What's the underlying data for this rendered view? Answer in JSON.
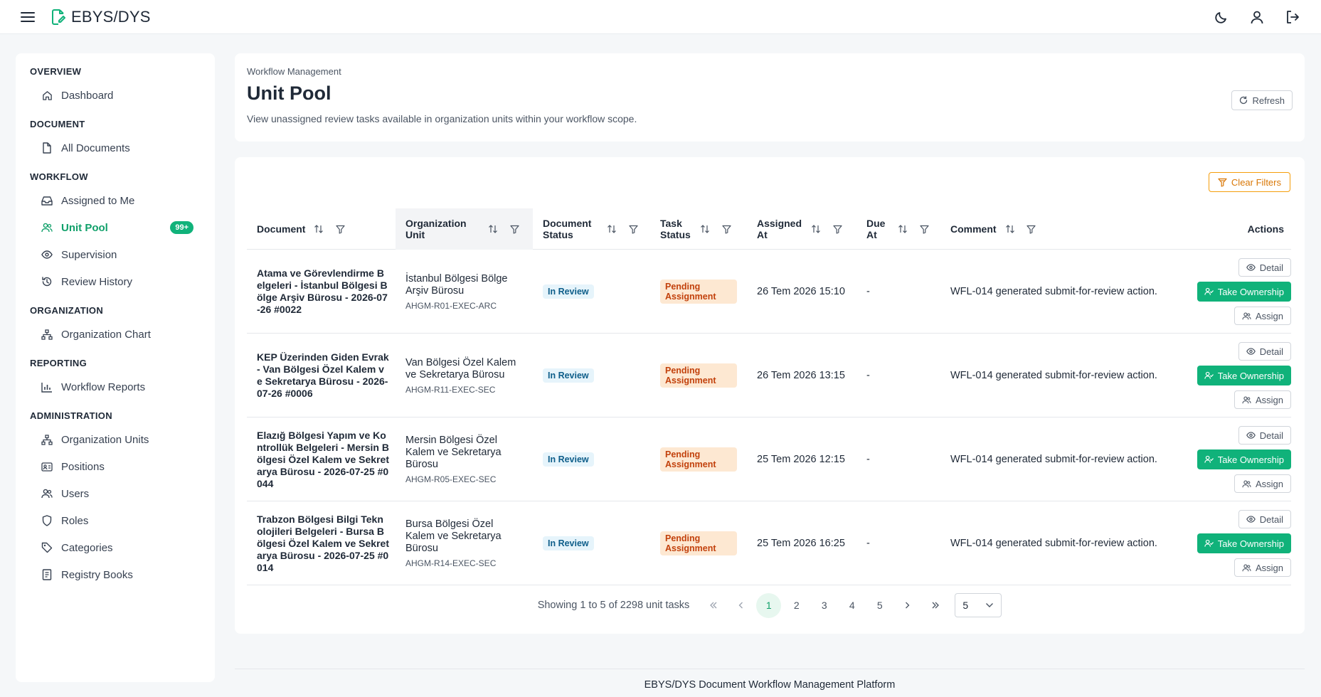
{
  "app": {
    "title": "EBYS/DYS"
  },
  "sidebar": {
    "sections": [
      {
        "label": "OVERVIEW",
        "items": [
          {
            "label": "Dashboard",
            "icon": "home-icon"
          }
        ]
      },
      {
        "label": "DOCUMENT",
        "items": [
          {
            "label": "All Documents",
            "icon": "file-icon"
          }
        ]
      },
      {
        "label": "WORKFLOW",
        "items": [
          {
            "label": "Assigned to Me",
            "icon": "inbox-icon"
          },
          {
            "label": "Unit Pool",
            "icon": "users-icon",
            "active": true,
            "badge": "99+"
          },
          {
            "label": "Supervision",
            "icon": "eye-icon"
          },
          {
            "label": "Review History",
            "icon": "history-icon"
          }
        ]
      },
      {
        "label": "ORGANIZATION",
        "items": [
          {
            "label": "Organization Chart",
            "icon": "sitemap-icon"
          }
        ]
      },
      {
        "label": "REPORTING",
        "items": [
          {
            "label": "Workflow Reports",
            "icon": "chart-icon"
          }
        ]
      },
      {
        "label": "ADMINISTRATION",
        "items": [
          {
            "label": "Organization Units",
            "icon": "sitemap-icon"
          },
          {
            "label": "Positions",
            "icon": "id-card-icon"
          },
          {
            "label": "Users",
            "icon": "users-icon"
          },
          {
            "label": "Roles",
            "icon": "shield-icon"
          },
          {
            "label": "Categories",
            "icon": "tag-icon"
          },
          {
            "label": "Registry Books",
            "icon": "book-icon"
          }
        ]
      }
    ]
  },
  "header": {
    "breadcrumb": "Workflow Management",
    "title": "Unit Pool",
    "description": "View unassigned review tasks available in organization units within your workflow scope.",
    "refresh_label": "Refresh"
  },
  "table": {
    "clear_filters_label": "Clear Filters",
    "columns": {
      "document": "Document",
      "org_unit": "Organization Unit",
      "doc_status": "Document Status",
      "task_status": "Task Status",
      "assigned_at": "Assigned At",
      "due_at": "Due At",
      "comment": "Comment",
      "actions": "Actions"
    },
    "action_labels": {
      "detail": "Detail",
      "take": "Take Ownership",
      "assign": "Assign"
    },
    "rows": [
      {
        "document": "Atama ve Görevlendirme Belgeleri - İstanbul Bölgesi Bölge Arşiv Bürosu - 2026-07-26 #0022",
        "org_name": "İstanbul Bölgesi Bölge Arşiv Bürosu",
        "org_code": "AHGM-R01-EXEC-ARC",
        "doc_status": "In Review",
        "task_status": "Pending Assignment",
        "assigned_at": "26 Tem 2026 15:10",
        "due_at": "-",
        "comment": "WFL-014 generated submit-for-review action."
      },
      {
        "document": "KEP Üzerinden Giden Evrak - Van Bölgesi Özel Kalem ve Sekretarya Bürosu - 2026-07-26 #0006",
        "org_name": "Van Bölgesi Özel Kalem ve Sekretarya Bürosu",
        "org_code": "AHGM-R11-EXEC-SEC",
        "doc_status": "In Review",
        "task_status": "Pending Assignment",
        "assigned_at": "26 Tem 2026 13:15",
        "due_at": "-",
        "comment": "WFL-014 generated submit-for-review action."
      },
      {
        "document": "Elazığ Bölgesi Yapım ve Kontrollük Belgeleri - Mersin Bölgesi Özel Kalem ve Sekretarya Bürosu - 2026-07-25 #0044",
        "org_name": "Mersin Bölgesi Özel Kalem ve Sekretarya Bürosu",
        "org_code": "AHGM-R05-EXEC-SEC",
        "doc_status": "In Review",
        "task_status": "Pending Assignment",
        "assigned_at": "25 Tem 2026 12:15",
        "due_at": "-",
        "comment": "WFL-014 generated submit-for-review action."
      },
      {
        "document": "Trabzon Bölgesi Bilgi Teknolojileri Belgeleri - Bursa Bölgesi Özel Kalem ve Sekretarya Bürosu - 2026-07-25 #0014",
        "org_name": "Bursa Bölgesi Özel Kalem ve Sekretarya Bürosu",
        "org_code": "AHGM-R14-EXEC-SEC",
        "doc_status": "In Review",
        "task_status": "Pending Assignment",
        "assigned_at": "25 Tem 2026 16:25",
        "due_at": "-",
        "comment": "WFL-014 generated submit-for-review action."
      }
    ]
  },
  "pagination": {
    "info": "Showing 1 to 5 of 2298 unit tasks",
    "pages": [
      "1",
      "2",
      "3",
      "4",
      "5"
    ],
    "current": "1",
    "page_size": "5"
  },
  "footer": {
    "text": "EBYS/DYS Document Workflow Management Platform"
  },
  "colors": {
    "accent": "#10b27a",
    "warning": "#d97706",
    "info": "#0e5e8a"
  }
}
